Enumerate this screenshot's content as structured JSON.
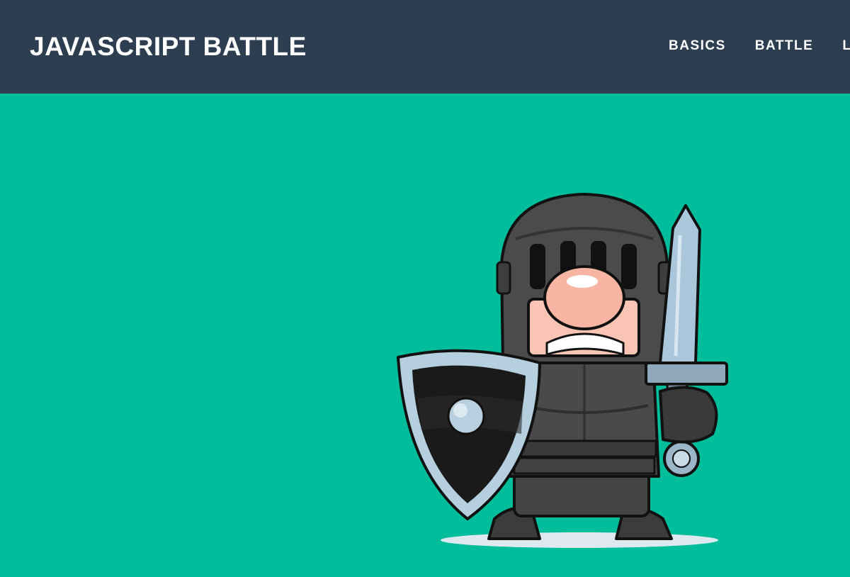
{
  "header": {
    "brand": "JAVASCRIPT BATTLE",
    "nav": [
      {
        "label": "BASICS"
      },
      {
        "label": "BATTLE"
      },
      {
        "label": "LE"
      }
    ]
  },
  "hero": {
    "image": "knight-with-sword-and-shield-illustration"
  },
  "colors": {
    "header_bg": "#2c3e50",
    "hero_bg": "#00bd9c",
    "nav_text": "#ffffff"
  }
}
